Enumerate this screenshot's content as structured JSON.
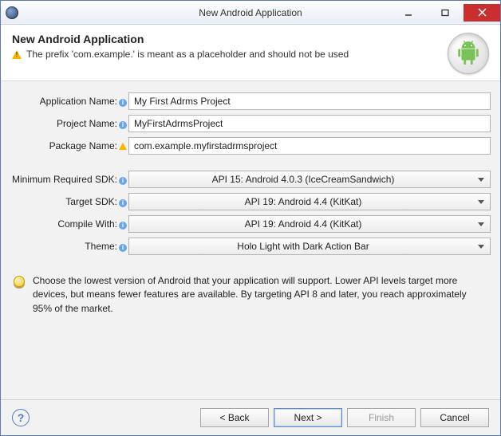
{
  "titlebar": {
    "title": "New Android Application"
  },
  "header": {
    "heading": "New Android Application",
    "warning": "The prefix 'com.example.' is meant as a placeholder and should not be used"
  },
  "form": {
    "appName": {
      "label": "Application Name:",
      "value": "My First Adrms Project"
    },
    "projectName": {
      "label": "Project Name:",
      "value": "MyFirstAdrmsProject"
    },
    "packageName": {
      "label": "Package Name:",
      "value": "com.example.myfirstadrmsproject"
    },
    "minSdk": {
      "label": "Minimum Required SDK:",
      "value": "API 15: Android 4.0.3 (IceCreamSandwich)"
    },
    "targetSdk": {
      "label": "Target SDK:",
      "value": "API 19: Android 4.4 (KitKat)"
    },
    "compileWith": {
      "label": "Compile With:",
      "value": "API 19: Android 4.4 (KitKat)"
    },
    "theme": {
      "label": "Theme:",
      "value": "Holo Light with Dark Action Bar"
    }
  },
  "tip": "Choose the lowest version of Android that your application will support. Lower API levels target more devices, but means fewer features are available. By targeting API 8 and later, you reach approximately 95% of the market.",
  "footer": {
    "back": "< Back",
    "next": "Next >",
    "finish": "Finish",
    "cancel": "Cancel"
  }
}
